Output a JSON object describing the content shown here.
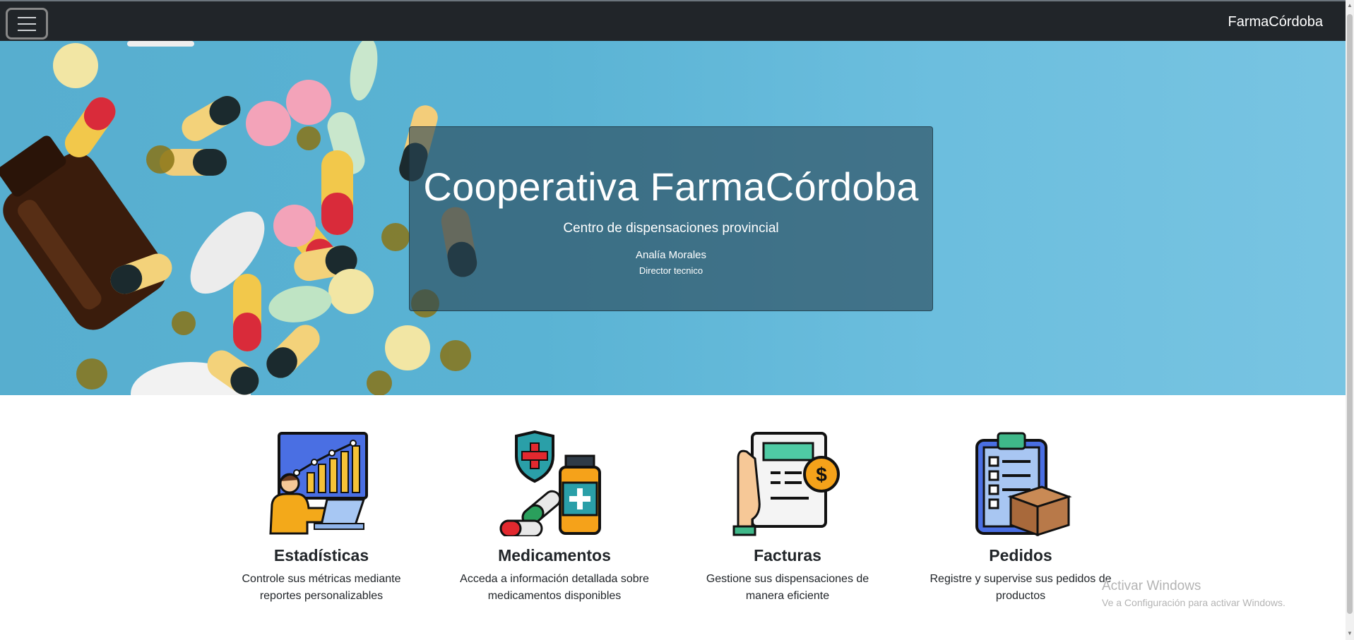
{
  "navbar": {
    "menu_icon": "hamburger-icon",
    "brand": "FarmaCórdoba"
  },
  "hero": {
    "title": "Cooperativa FarmaCórdoba",
    "subtitle": "Centro de dispensaciones provincial",
    "name": "Analía Morales",
    "role": "Director tecnico"
  },
  "features": [
    {
      "icon": "statistics-icon",
      "title": "Estadísticas",
      "description": "Controle sus métricas mediante reportes personalizables"
    },
    {
      "icon": "medicine-icon",
      "title": "Medicamentos",
      "description": "Acceda a información detallada sobre medicamentos disponibles"
    },
    {
      "icon": "invoice-icon",
      "title": "Facturas",
      "description": "Gestione sus dispensaciones de manera eficiente"
    },
    {
      "icon": "orders-icon",
      "title": "Pedidos",
      "description": "Registre y supervise sus pedidos de productos"
    }
  ],
  "watermark": {
    "title": "Activar Windows",
    "subtitle": "Ve a Configuración para activar Windows."
  },
  "colors": {
    "navbar": "#212529",
    "hero_bg": "#5ab3d4",
    "card_overlay": "#284655"
  }
}
